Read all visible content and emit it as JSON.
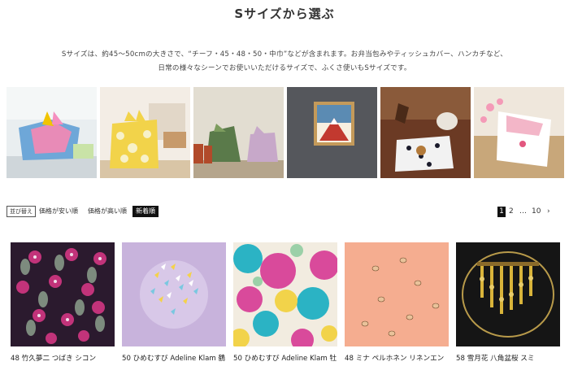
{
  "section": {
    "title": "Sサイズから選ぶ",
    "description_line1": "Sサイズは、約45～50cmの大きさで、“チーフ・45・48・50・中巾”などが含まれます。お弁当包みやティッシュカバー、ハンカチなど、",
    "description_line2": "日常の様々なシーンでお使いいただけるサイズで、ふくさ使いもSサイズです。"
  },
  "scenes": [
    {
      "name": "lunchbox-wrap"
    },
    {
      "name": "yellow-lemon-wrap"
    },
    {
      "name": "gift-bottles-wrap"
    },
    {
      "name": "framed-fuji-art"
    },
    {
      "name": "teapot-table-mat"
    },
    {
      "name": "pink-cherry-gift"
    }
  ],
  "sort": {
    "label": "並び替え",
    "options": [
      "価格が安い順",
      "価格が高い順",
      "新着順"
    ],
    "active": "新着順"
  },
  "pagination": {
    "pages": [
      "1",
      "2",
      "…",
      "10",
      "›"
    ],
    "current": "1"
  },
  "products": [
    {
      "name": "48 竹久夢二 つばき シコン",
      "icon": "camellia-pattern"
    },
    {
      "name": "50 ひめむすび Adeline Klam 鶴",
      "icon": "crane-pattern"
    },
    {
      "name": "50 ひめむすび Adeline Klam 牡",
      "icon": "peony-pattern"
    },
    {
      "name": "48 ミナ ペルホネン リネンエン",
      "icon": "shoe-pattern"
    },
    {
      "name": "58 雪月花 八角盆桜 スミ",
      "icon": "wisteria-pattern"
    }
  ],
  "colors": {
    "accent": "#111111",
    "text": "#333333"
  }
}
